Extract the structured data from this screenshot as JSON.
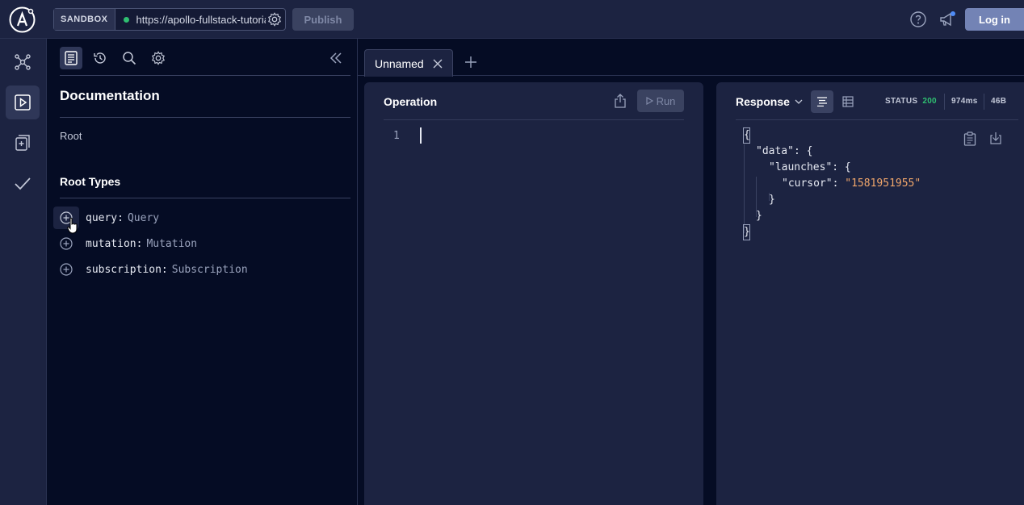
{
  "topbar": {
    "sandbox_label": "SANDBOX",
    "url": "https://apollo-fullstack-tutorial",
    "publish_label": "Publish",
    "login_label": "Log in"
  },
  "rail": {
    "items": [
      "schema-icon",
      "explorer-icon",
      "checks-icon",
      "check-icon"
    ],
    "active": "explorer-icon"
  },
  "docs": {
    "title": "Documentation",
    "breadcrumb": "Root",
    "section_title": "Root Types",
    "types": [
      {
        "field": "query:",
        "type": "Query"
      },
      {
        "field": "mutation:",
        "type": "Mutation"
      },
      {
        "field": "subscription:",
        "type": "Subscription"
      }
    ]
  },
  "tabs": {
    "items": [
      {
        "label": "Unnamed"
      }
    ]
  },
  "operation": {
    "title": "Operation",
    "run_label": "Run",
    "line_number": "1"
  },
  "response": {
    "title": "Response",
    "status_label": "STATUS",
    "status_code": "200",
    "time": "974ms",
    "size": "46B",
    "json_lines": {
      "l1": "{",
      "l2": "\"data\": {",
      "l3": "\"launches\": {",
      "l4_key": "\"cursor\": ",
      "l4_val": "\"1581951955\"",
      "l5": "}",
      "l6": "}",
      "l7": "}"
    }
  },
  "colors": {
    "background": "#050c24",
    "panel": "#1c2341",
    "accent": "#7383b5",
    "status_ok": "#2fbf71",
    "string_value": "#f2a76b"
  }
}
